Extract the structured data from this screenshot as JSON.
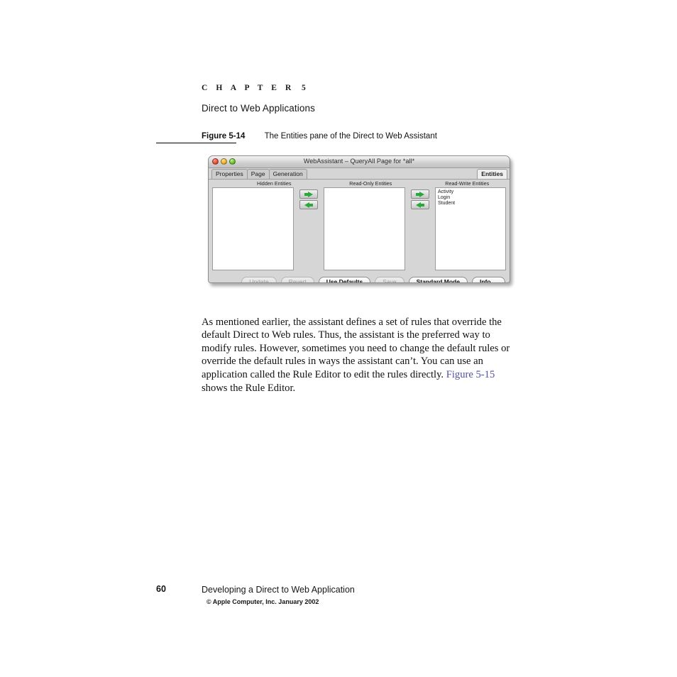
{
  "page": {
    "chapter_label": "C H A P T E R",
    "chapter_number": "5",
    "chapter_title": "Direct to Web Applications"
  },
  "figure": {
    "label": "Figure",
    "number": "5-14",
    "caption": "The Entities pane of the Direct to Web Assistant"
  },
  "window": {
    "title": "WebAssistant – QueryAll Page for *all*",
    "controls": {
      "close": "close-button",
      "minimize": "minimize-button",
      "zoom": "zoom-button"
    },
    "tabs": [
      {
        "label": "Properties",
        "active": false
      },
      {
        "label": "Page",
        "active": false
      },
      {
        "label": "Generation",
        "active": false
      }
    ],
    "right_tab": {
      "label": "Entities",
      "active": true
    },
    "columns": [
      {
        "header": "Hidden Entities",
        "items": []
      },
      {
        "header": "Read-Only Entities",
        "items": []
      },
      {
        "header": "Read-Write Entities",
        "items": [
          "Activity",
          "Login",
          "Student"
        ]
      }
    ],
    "transfer_controls": [
      {
        "move_right": "→",
        "move_left": "←"
      },
      {
        "move_right": "→",
        "move_left": "←"
      }
    ],
    "buttons": [
      {
        "label": "Update",
        "enabled": false
      },
      {
        "label": "Revert",
        "enabled": false
      },
      {
        "label": "Use Defaults",
        "enabled": true
      },
      {
        "label": "Save",
        "enabled": false
      },
      {
        "label": "Standard Mode",
        "enabled": true
      },
      {
        "label": "Info ...",
        "enabled": true
      }
    ],
    "accent_color": "#2aa83a"
  },
  "body": {
    "part1": "As mentioned earlier, the assistant defines a set of rules that override the default Direct to Web rules. Thus, the assistant is the preferred way to modify rules. However, sometimes you need to change the default rules or override the default rules in ways the assistant can’t. You can use an application called the Rule Editor to edit the rules directly. ",
    "xref": "Figure 5-15",
    "part2": " shows the Rule Editor."
  },
  "footer": {
    "page_number": "60",
    "title": "Developing a Direct to Web Application",
    "copyright": "© Apple Computer, Inc. January 2002"
  }
}
